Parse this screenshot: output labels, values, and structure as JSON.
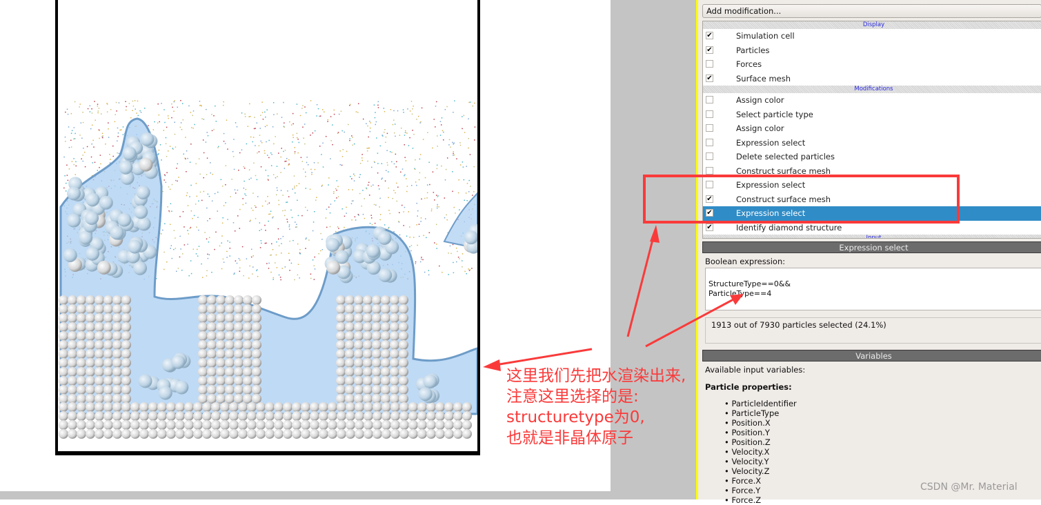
{
  "panel": {
    "add_modification": "Add modification...",
    "sections": {
      "display": "Display",
      "modifications": "Modifications",
      "input": "Input"
    },
    "display_items": [
      {
        "label": "Simulation cell",
        "checked": true
      },
      {
        "label": "Particles",
        "checked": true
      },
      {
        "label": "Forces",
        "checked": false
      },
      {
        "label": "Surface mesh",
        "checked": true
      }
    ],
    "modification_items": [
      {
        "label": "Assign color",
        "checked": false,
        "selected": false
      },
      {
        "label": "Select particle type",
        "checked": false,
        "selected": false
      },
      {
        "label": "Assign color",
        "checked": false,
        "selected": false
      },
      {
        "label": "Expression select",
        "checked": false,
        "selected": false
      },
      {
        "label": "Delete selected particles",
        "checked": false,
        "selected": false
      },
      {
        "label": "Construct surface mesh",
        "checked": false,
        "selected": false
      },
      {
        "label": "Expression select",
        "checked": false,
        "selected": false
      },
      {
        "label": "Construct surface mesh",
        "checked": true,
        "selected": false
      },
      {
        "label": "Expression select",
        "checked": true,
        "selected": true
      },
      {
        "label": "Identify diamond structure",
        "checked": true,
        "selected": false
      }
    ],
    "editor_title": "Expression select",
    "boolean_expression_label": "Boolean expression:",
    "expression": "StructureType==0&&\nParticleType==4",
    "status": "1913 out of 7930 particles selected (24.1%)",
    "variables_title": "Variables",
    "available_label": "Available input variables:",
    "particle_properties_label": "Particle properties:",
    "variables": [
      "ParticleIdentifier",
      "ParticleType",
      "Position.X",
      "Position.Y",
      "Position.Z",
      "Velocity.X",
      "Velocity.Y",
      "Velocity.Z",
      "Force.X",
      "Force.Y",
      "Force.Z"
    ]
  },
  "annotation": {
    "lines": [
      "这里我们先把水渲染出来,",
      "注意这里选择的是:",
      "structuretype为0,",
      "也就是非晶体原子"
    ],
    "color": "#fa3a3a"
  },
  "watermark": "CSDN @Mr. Material",
  "colors": {
    "selection": "#308cc6",
    "water": "#a9cdf2",
    "annotation": "#fa3a3a"
  }
}
